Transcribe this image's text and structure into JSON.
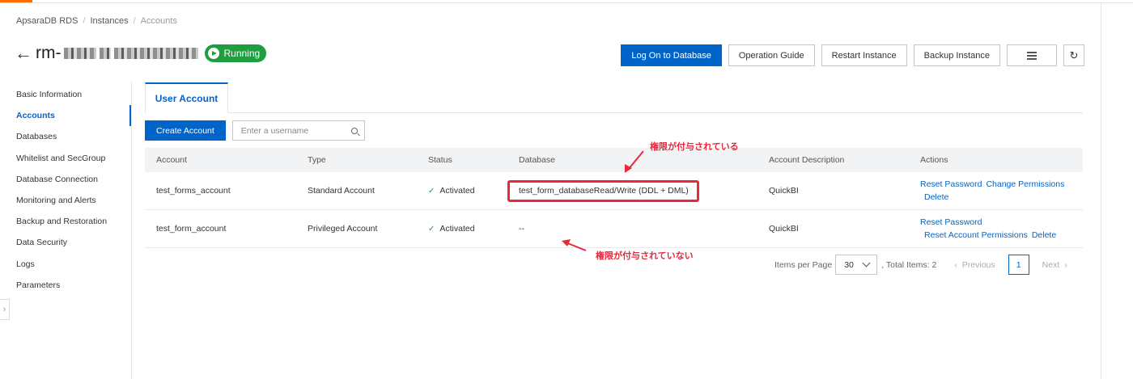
{
  "breadcrumb": [
    "ApsaraDB RDS",
    "Instances",
    "Accounts"
  ],
  "instance": {
    "name_prefix": "rm-",
    "status": "Running"
  },
  "top_actions": {
    "log_on": "Log On to Database",
    "operation_guide": "Operation Guide",
    "restart": "Restart Instance",
    "backup": "Backup Instance",
    "menu_icon": "menu-icon",
    "refresh_icon": "refresh-icon",
    "refresh_glyph": "↻"
  },
  "sidebar": {
    "items": [
      {
        "label": "Basic Information"
      },
      {
        "label": "Accounts",
        "active": true
      },
      {
        "label": "Databases"
      },
      {
        "label": "Whitelist and SecGroup"
      },
      {
        "label": "Database Connection"
      },
      {
        "label": "Monitoring and Alerts"
      },
      {
        "label": "Backup and Restoration"
      },
      {
        "label": "Data Security"
      },
      {
        "label": "Logs"
      },
      {
        "label": "Parameters"
      }
    ]
  },
  "tabs": [
    {
      "label": "User Account"
    }
  ],
  "toolbar": {
    "create_label": "Create Account",
    "search_placeholder": "Enter a username"
  },
  "table": {
    "columns": [
      "Account",
      "Type",
      "Status",
      "Database",
      "Account Description",
      "Actions"
    ],
    "rows": [
      {
        "account": "test_forms_account",
        "type": "Standard Account",
        "status": "Activated",
        "database": "test_form_databaseRead/Write (DDL + DML)",
        "description": "QuickBI",
        "actions": {
          "reset": "Reset Password",
          "change": "Change Permissions",
          "delete": "Delete"
        }
      },
      {
        "account": "test_form_account",
        "type": "Privileged Account",
        "status": "Activated",
        "database": "--",
        "description": "QuickBI",
        "actions": {
          "reset": "Reset Password",
          "reset_perm": "Reset Account Permissions",
          "delete": "Delete"
        }
      }
    ]
  },
  "annotations": {
    "granted": "権限が付与されている",
    "not_granted": "権限が付与されていない",
    "color": "#e8283b"
  },
  "pagination": {
    "items_per_page_label": "Items per Page",
    "items_per_page": "30",
    "total": ", Total Items: 2",
    "prev": "Previous",
    "next": "Next",
    "current_page": "1"
  },
  "colors": {
    "primary": "#0064c8",
    "success": "#1e9e3e",
    "brand_accent": "#ff6a00"
  }
}
